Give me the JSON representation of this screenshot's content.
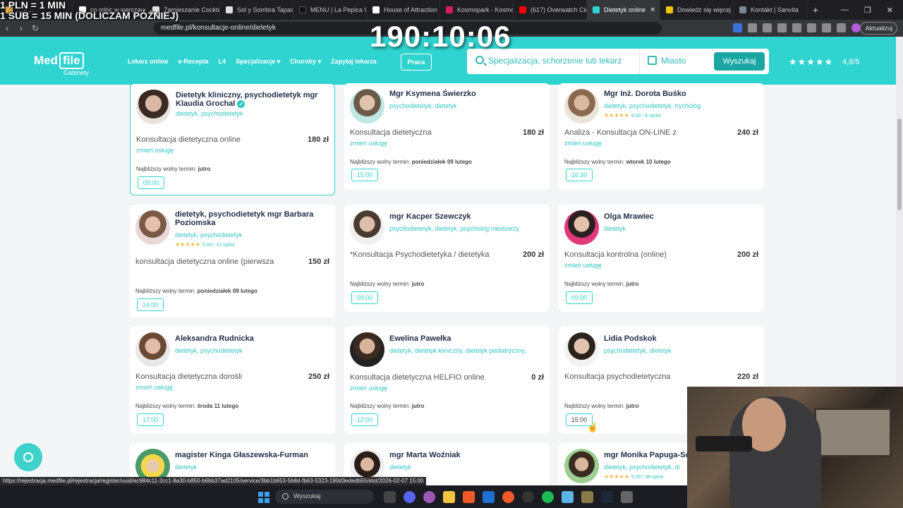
{
  "overlay": {
    "line1": "1 PLN = 1 MIN",
    "line2": "1 SUB = 15 MIN (DOLICZAM PÓŹNIEJ)",
    "timer": "190:10:06"
  },
  "browser": {
    "tabs": [
      {
        "title": "... - ...",
        "fav": "#f2b640"
      },
      {
        "title": "co robic w warszaw",
        "fav": "#ffffff"
      },
      {
        "title": "Zamieszanie Cockta",
        "fav": "#e5e5e5"
      },
      {
        "title": "Sol y Sombra Tapas",
        "fav": "#e0e0e0"
      },
      {
        "title": "MENU | La Pepica W",
        "fav": "#111111"
      },
      {
        "title": "House of Attraction",
        "fav": "#ffffff"
      },
      {
        "title": "Kosmopark - Kosmo",
        "fav": "#d81b60"
      },
      {
        "title": "(617) Overwatch Cir",
        "fav": "#ff0000"
      },
      {
        "title": "Dietetyk online",
        "fav": "#2fd3cf"
      },
      {
        "title": "Dowiedz się więcej",
        "fav": "#f1c40f"
      },
      {
        "title": "Kontakt | Sanvita",
        "fav": "#7b8794"
      }
    ],
    "url": "medfile.pl/konsultacje-online/dietetyk",
    "update_label": "Aktualizuj",
    "status_url": "https://rejestracja.medfile.pl/rejestracja/register/uuid/ec984c11-2cc1-8a30-b850-b6bb37ad2105/service/3bb1b653-5b8d-fb63-5323-190d3ededb55/slot/2026-02-07 15:00"
  },
  "header": {
    "logo_med": "Med",
    "logo_file": "file",
    "logo_sub": "Gabinety",
    "nav": [
      "Lekarz online",
      "e-Recepta",
      "L4",
      "Specjalizacje",
      "Choroby",
      "Zapytaj lekarza"
    ],
    "praca": "Praca",
    "search_placeholder": "Specjalizacja, schorzenie lub lekarz",
    "city_placeholder": "Miasto",
    "search_button": "Wyszukaj",
    "stars": "★★★★★",
    "rating": "4,8/5"
  },
  "cards": [
    {
      "name": "Dietetyk kliniczny, psychodietetyk mgr Klaudia Grochal",
      "spec": "dietetyk, psychodietetyk",
      "service": "Konsultacja dietetyczna online",
      "price": "180 zł",
      "change": "zmień usługę",
      "next_label": "Najbliższy wolny termin:",
      "next_date": "jutro",
      "slot": "09:00"
    },
    {
      "name": "Mgr Ksymena Świerzko",
      "spec": "psychodietetyk, dietetyk",
      "service": "Konsultacja dietetyczna",
      "price": "180 zł",
      "change": "zmień usługę",
      "next_label": "Najbliższy wolny termin:",
      "next_date": "poniedziałek 09 lutego",
      "slot": "15:00"
    },
    {
      "name": "Mgr Inż. Dorota Buśko",
      "spec": "dietetyk, psychodietetyk, trycholog",
      "stars": "★★★★★",
      "reviews": "5.00 / 6 opinii",
      "service": "Analiza - Konsultacja ON-LINE z",
      "price": "240 zł",
      "change": "zmień usługę",
      "next_label": "Najbliższy wolny termin:",
      "next_date": "wtorek 10 lutego",
      "slot": "16:30"
    },
    {
      "name": "dietetyk, psychodietetyk mgr Barbara Poziomska",
      "spec": "dietetyk, psychodietetyk",
      "stars": "★★★★★",
      "reviews": "5.00 / 12 opinii",
      "service": "konsultacja dietetyczna online (pierwsza",
      "price": "150 zł",
      "next_label": "Najbliższy wolny termin:",
      "next_date": "poniedziałek 09 lutego",
      "slot": "14:00"
    },
    {
      "name": "mgr Kacper Szewczyk",
      "spec": "psychodietetyk, dietetyk, psycholog młodzieży",
      "service": "*Konsultacja Psychodietetyka / dietetyka",
      "price": "200 zł",
      "next_label": "Najbliższy wolny termin:",
      "next_date": "jutro",
      "slot": "09:00"
    },
    {
      "name": "Olga Mrawiec",
      "spec": "dietetyk",
      "service": "Konsultacja kontrolna (online)",
      "price": "200 zł",
      "change": "zmień usługę",
      "next_label": "Najbliższy wolny termin:",
      "next_date": "jutro",
      "slot": "09:00"
    },
    {
      "name": "Aleksandra Rudnicka",
      "spec": "dietetyk, psychodietetyk",
      "service": "Konsultacja dietetyczna dorośli",
      "price": "250 zł",
      "change": "zmień usługę",
      "next_label": "Najbliższy wolny termin:",
      "next_date": "środa 11 lutego",
      "slot": "17:00"
    },
    {
      "name": "Ewelina Pawełka",
      "spec": "dietetyk, dietetyk kliniczny, dietetyk pediatryczny,",
      "service": "Konsultacja dietetyczna HELFIO online",
      "price": "0 zł",
      "change": "zmień usługę",
      "next_label": "Najbliższy wolny termin:",
      "next_date": "jutro",
      "slot": "12:00"
    },
    {
      "name": "Lidia Podskok",
      "spec": "psychodietetyk, dietetyk",
      "service": "Konsultacja psychodietetyczna",
      "price": "220 zł",
      "next_label": "Najbliższy wolny termin:",
      "next_date": "jutro",
      "slot": "15:00"
    },
    {
      "name": "magister Kinga Głaszewska-Furman",
      "spec": "dietetyk"
    },
    {
      "name": "mgr Marta Woźniak",
      "spec": "dietetyk"
    },
    {
      "name": "mgr Monika Papuga-So",
      "spec": "dietetyk, psychodietetyk, di",
      "stars": "★★★★★",
      "reviews": "5.00 / 38 opinii"
    }
  ],
  "taskbar": {
    "search": "Wyszukaj"
  },
  "colors": {
    "brand": "#2fd3cf",
    "brand_dark": "#1aa6a3",
    "star": "#f6b73c"
  }
}
